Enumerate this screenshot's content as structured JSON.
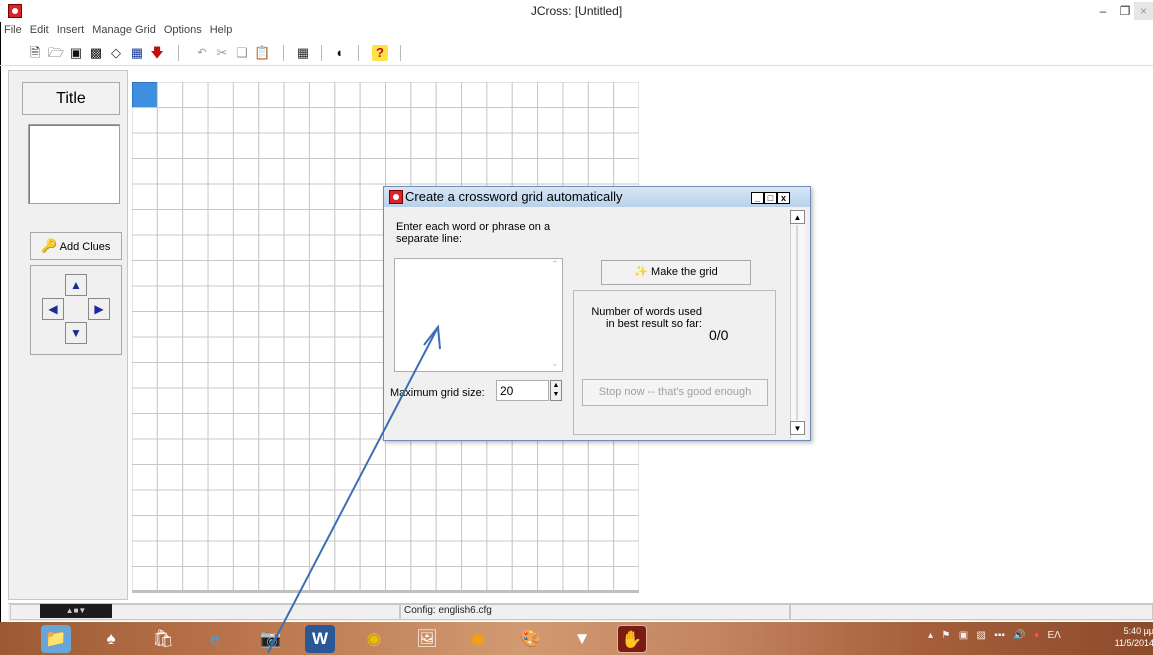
{
  "app": {
    "title": "JCross: [Untitled]",
    "accent": "#d8242a"
  },
  "menu": [
    "File",
    "Edit",
    "Insert",
    "Manage Grid",
    "Options",
    "Help"
  ],
  "toolbar_icons": [
    "new-file-icon",
    "open-folder-icon",
    "save-icon",
    "save-as-icon",
    "eraser-icon",
    "export-web-icon",
    "export-down-icon",
    "undo-icon",
    "cut-icon",
    "copy-icon",
    "paste-icon",
    "grid-maker-icon",
    "configure-output-icon",
    "help-icon"
  ],
  "left_panel": {
    "title_button": "Title",
    "add_clues_button": "Add Clues"
  },
  "grid": {
    "rows": 20,
    "cols": 20,
    "selected_cell_color": "#3d8fe0"
  },
  "dialog": {
    "title": "Create a crossword grid automatically",
    "instruction": "Enter each word or phrase on a separate line:",
    "words_value": "",
    "grid_size_label": "Maximum grid size:",
    "grid_size_value": "20",
    "make_grid_button": "Make the grid",
    "result_label": "Number of words used in best result so far:",
    "result_value": "0/0",
    "stop_button": "Stop now -- that's good enough",
    "min_label": "_",
    "max_label": "□",
    "close_label": "x"
  },
  "status": {
    "config": "Config: english6.cfg"
  },
  "taskbar": {
    "apps": [
      "file-explorer-icon",
      "games-icon",
      "store-icon",
      "internet-explorer-icon",
      "camera-icon",
      "word-icon",
      "chrome-icon",
      "photos-icon",
      "firefox-icon",
      "paint-icon",
      "media-player-icon",
      "jcross-icon"
    ],
    "language": "EΛ",
    "time": "5:40 μμ",
    "date": "11/5/2014"
  }
}
